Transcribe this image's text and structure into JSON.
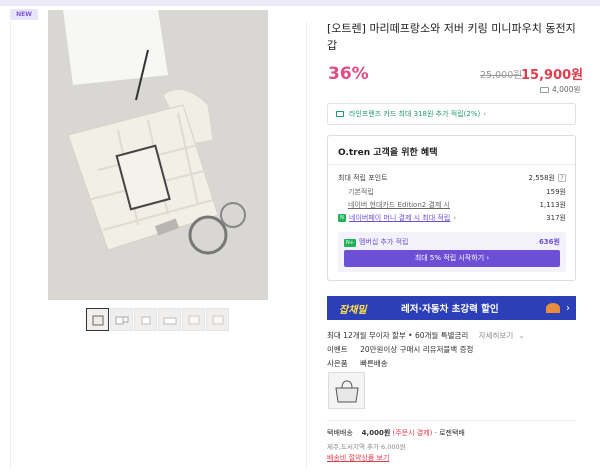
{
  "badge": "NEW",
  "product": {
    "title": "[오트렌] 마리떼프랑소와 저버 키링 미니파우치 동전지갑",
    "discount": "36%",
    "original_price": "25,000원",
    "sale_price": "15,900원",
    "coupon_amount": "4,000원"
  },
  "card_banner": "라인프렌즈 카드 최대 318원 추가 적립(2%)",
  "benefits": {
    "title": "O.tren 고객을 위한 혜택",
    "max_points_label": "최대 적립 포인트",
    "max_points_value": "2,558원",
    "rows": [
      {
        "label": "기본적립",
        "value": "159원"
      },
      {
        "label": "네이버 현대카드 Edition2 결제 시",
        "value": "1,113원"
      },
      {
        "label": "네이버페이 머니 결제 시 최대 적립",
        "value": "317원"
      }
    ],
    "member_label": "멤버십 추가 적립",
    "member_value": "636원",
    "member_button": "최대 5% 적립 시작하기"
  },
  "promo": {
    "logo": "잡채밀",
    "text": "레저·자동차 초강력 할인"
  },
  "info": {
    "installment": "최대 12개월 무이자 할부 • 60개월 특별금리",
    "installment_link": "자세히보기",
    "event_key": "이벤트",
    "event_value": "20만원이상 구매시 리유저블백 증정",
    "gift_key": "사은품",
    "gift_value": "빠른배송"
  },
  "shipping": {
    "label": "택배배송",
    "price": "4,000원",
    "condition": "(주문시 결제)",
    "carrier": "로젠택배",
    "extra": "제주,도서지역 추가 6,000원",
    "link": "배송비 절약상품 보기"
  },
  "colors": {
    "discount": "#e04d86",
    "sale_price": "#e03d4d",
    "accent_purple": "#6c4fd4",
    "card_green": "#1e9a6c",
    "promo_bg": "#2a3fb8"
  }
}
